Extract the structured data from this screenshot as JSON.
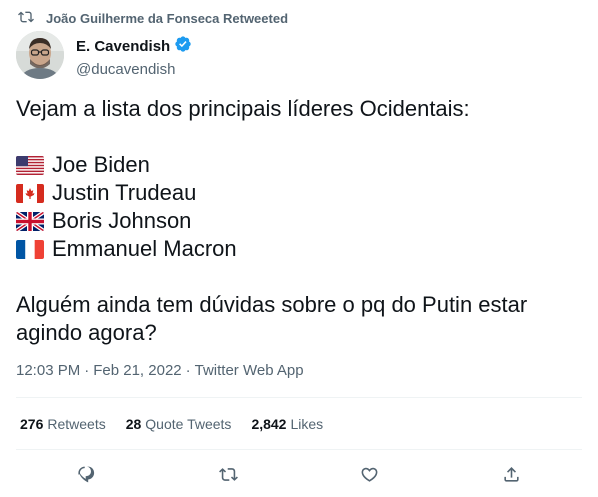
{
  "retweet_header": {
    "text": "João Guilherme da Fonseca Retweeted",
    "icon": "retweet-icon"
  },
  "author": {
    "display_name": "E. Cavendish",
    "handle": "@ducavendish",
    "verified": true,
    "avatar": "avatar-photo"
  },
  "tweet": {
    "intro": "Vejam a lista dos principais líderes Ocidentais:",
    "leaders": [
      {
        "flag": "us-flag-icon",
        "name": "Joe Biden"
      },
      {
        "flag": "canada-flag-icon",
        "name": "Justin Trudeau"
      },
      {
        "flag": "uk-flag-icon",
        "name": "Boris Johnson"
      },
      {
        "flag": "france-flag-icon",
        "name": "Emmanuel Macron"
      }
    ],
    "question": "Alguém ainda tem dúvidas sobre o pq do Putin estar agindo agora?"
  },
  "meta": {
    "time": "12:03 PM",
    "date": "Feb 21, 2022",
    "source": "Twitter Web App",
    "separator": "·"
  },
  "stats": {
    "retweets_count": "276",
    "retweets_label": "Retweets",
    "quotes_count": "28",
    "quotes_label": "Quote Tweets",
    "likes_count": "2,842",
    "likes_label": "Likes"
  },
  "actions": [
    "reply-icon",
    "retweet-icon",
    "like-icon",
    "share-icon"
  ],
  "colors": {
    "text": "#0f1419",
    "secondary": "#536471",
    "verified": "#1d9bf0",
    "divider": "#eff3f4"
  }
}
